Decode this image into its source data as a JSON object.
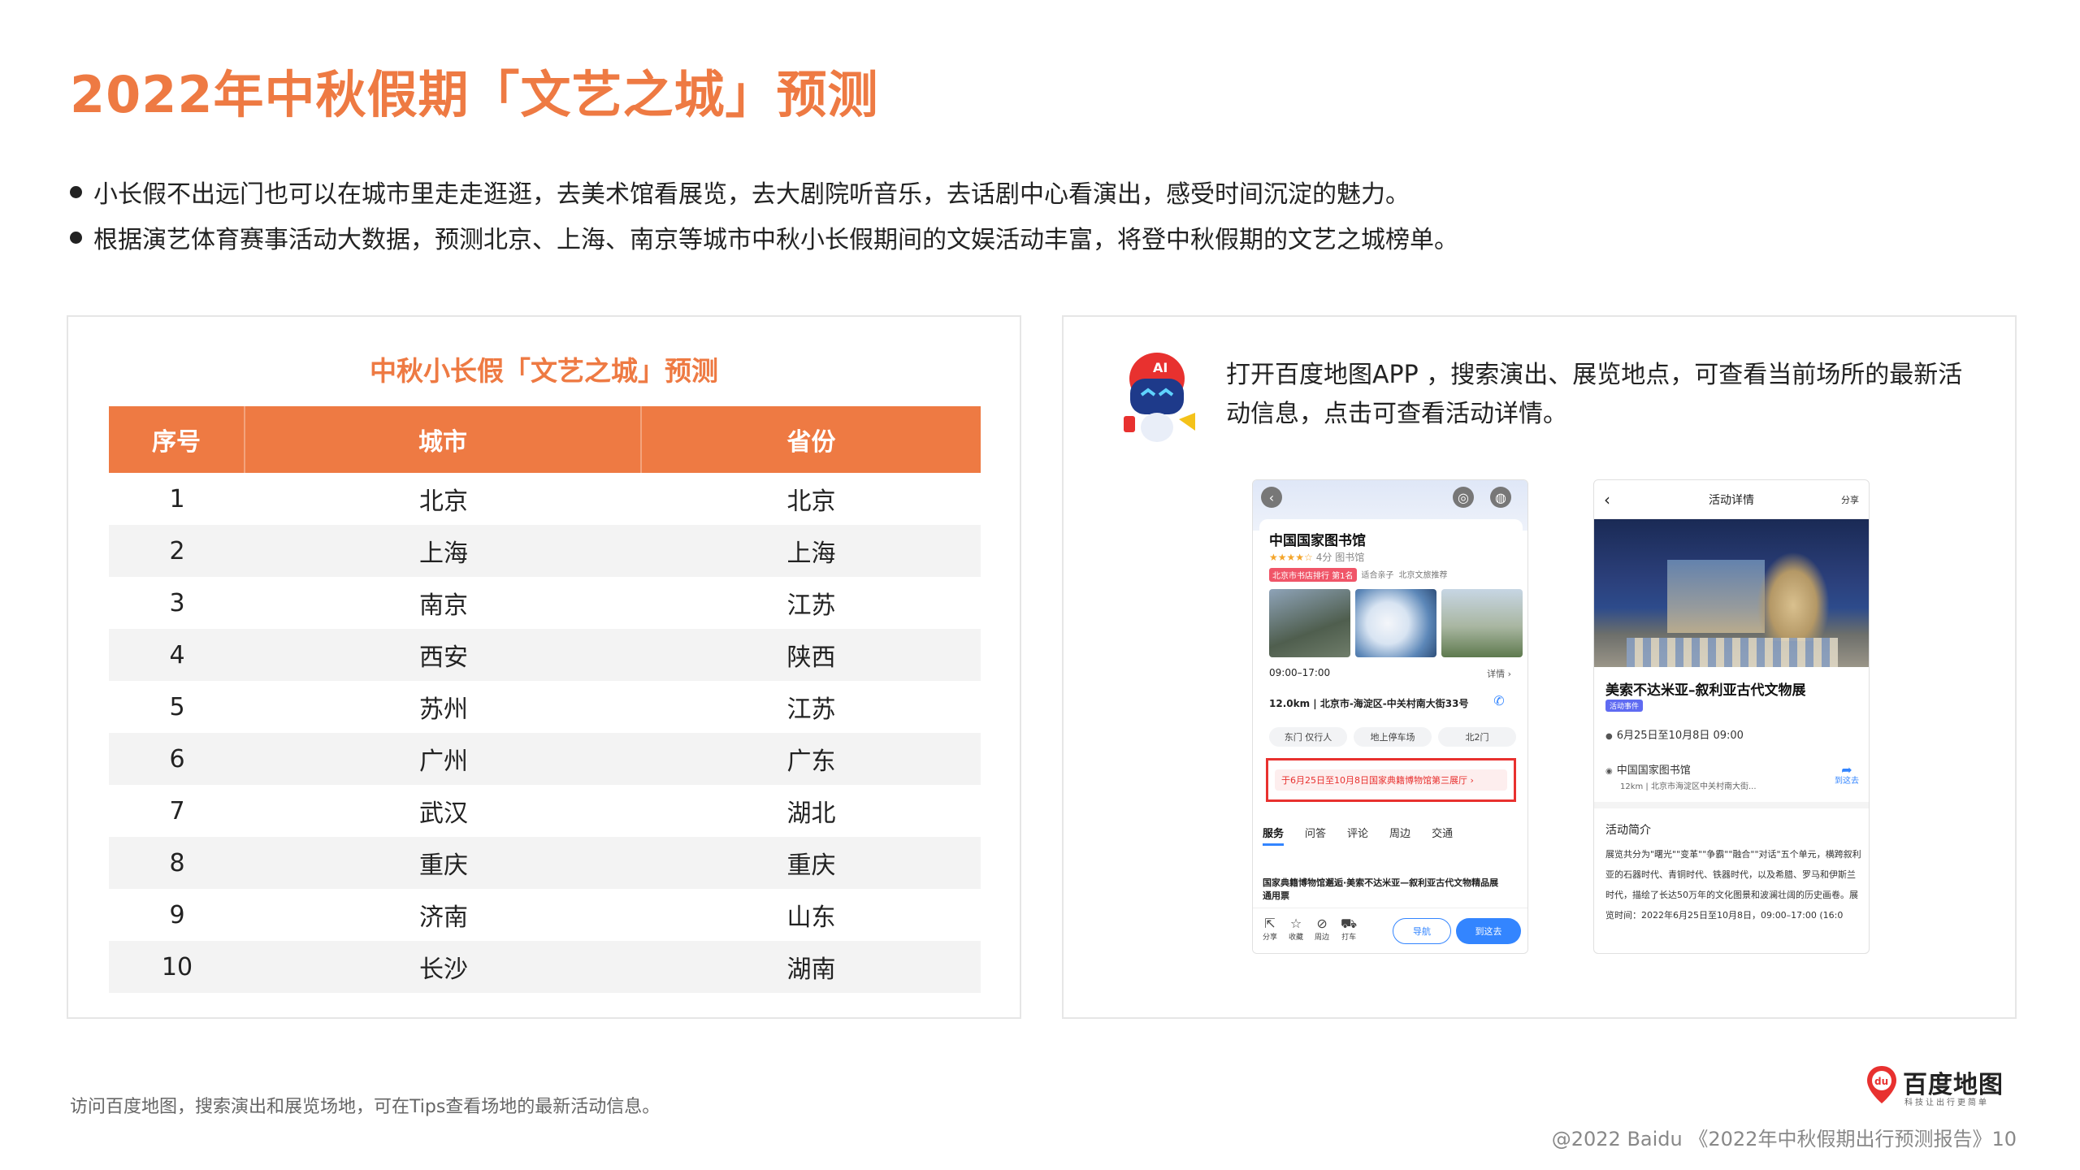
{
  "page": {
    "title": "2022年中秋假期「文艺之城」预测",
    "bullets": [
      "小长假不出远门也可以在城市里走走逛逛，去美术馆看展览，去大剧院听音乐，去话剧中心看演出，感受时间沉淀的魅力。",
      "根据演艺体育赛事活动大数据，预测北京、上海、南京等城市中秋小长假期间的文娱活动丰富，将登中秋假期的文艺之城榜单。"
    ],
    "footnote": "访问百度地图，搜索演出和展览场地，可在Tips查看场地的最新活动信息。",
    "copyright": "@2022 Baidu 《2022年中秋假期出行预测报告》10"
  },
  "ranking_table": {
    "title": "中秋小长假「文艺之城」预测",
    "headers": [
      "序号",
      "城市",
      "省份"
    ],
    "rows": [
      [
        "1",
        "北京",
        "北京"
      ],
      [
        "2",
        "上海",
        "上海"
      ],
      [
        "3",
        "南京",
        "江苏"
      ],
      [
        "4",
        "西安",
        "陕西"
      ],
      [
        "5",
        "苏州",
        "江苏"
      ],
      [
        "6",
        "广州",
        "广东"
      ],
      [
        "7",
        "武汉",
        "湖北"
      ],
      [
        "8",
        "重庆",
        "重庆"
      ],
      [
        "9",
        "济南",
        "山东"
      ],
      [
        "10",
        "长沙",
        "湖南"
      ]
    ]
  },
  "right_panel": {
    "mascot_label": "AI",
    "intro": "打开百度地图APP ，搜索演出、展览地点，可查看当前场所的最新活动信息，点击可查看活动详情。",
    "phone1": {
      "place_name": "中国国家图书馆",
      "rating": "★★★★☆",
      "rating_text": "4分 图书馆",
      "rank_tag": "北京市书店排行 第1名",
      "tag2": "适合亲子",
      "tag3": "北京文旅推荐",
      "hours": "09:00–17:00",
      "detail": "详情 ›",
      "address": "12.0km | 北京市-海淀区-中关村南大街33号",
      "chips": [
        "东门 仅行人",
        "地上停车场",
        "北2门"
      ],
      "tip": "于6月25日至10月8日国家典籍博物馆第三展厅 ›",
      "tabs": [
        "服务",
        "问答",
        "评论",
        "周边",
        "交通"
      ],
      "news": "国家典籍博物馆邂逅·美索不达米亚—叙利亚古代文物精品展通用票",
      "bottom_icons": [
        "分享",
        "收藏",
        "周边",
        "打车"
      ],
      "nav_label": "导航",
      "go_label": "到这去"
    },
    "phone2": {
      "header_title": "活动详情",
      "share": "分享",
      "exhibit_name": "美索不达米亚–叙利亚古代文物展",
      "badge": "活动事件",
      "date": "6月25日至10月8日 09:00",
      "place": "中国国家图书馆",
      "distance": "12km | 北京市海淀区中关村南大街...",
      "goto": "到这去",
      "intro_heading": "活动简介",
      "intro": "展览共分为\"曙光\"\"变革\"\"争霸\"\"融合\"\"对话\"五个单元，横跨叙利亚的石器时代、青铜时代、铁器时代，以及希腊、罗马和伊斯兰时代，描绘了长达50万年的文化图景和波澜壮阔的历史画卷。展览时间：2022年6月25日至10月8日，09:00–17:00 (16:0"
    }
  },
  "logo": {
    "name": "百度地图",
    "slogan": "科技让出行更简单",
    "pin_text": "du"
  },
  "colors": {
    "accent": "#EE7A43",
    "tip_red": "#E8312F",
    "link_blue": "#3385FF"
  }
}
